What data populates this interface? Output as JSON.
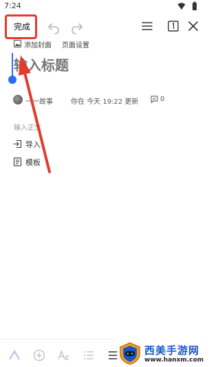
{
  "status_bar": {
    "time": "7:24"
  },
  "toolbar": {
    "done_label": "完成"
  },
  "cover_row": {
    "add_cover_label": "添加封面",
    "page_settings_label": "页面设置"
  },
  "title": {
    "placeholder": "输入标题"
  },
  "author_row": {
    "author_name": "一一故事",
    "last_edit": "你在 今天 19:22 更新",
    "comment_count": "0"
  },
  "body": {
    "placeholder": "输入正文",
    "actions": [
      {
        "label": "导入",
        "icon": "import-icon"
      },
      {
        "label": "模板",
        "icon": "template-icon"
      }
    ]
  },
  "watermark": {
    "title": "西美手游网",
    "url": "www.hanxm.com"
  },
  "colors": {
    "accent": "#2e6bf0",
    "annotation": "#e23b2c",
    "watermark_blue": "#1a56c8"
  }
}
